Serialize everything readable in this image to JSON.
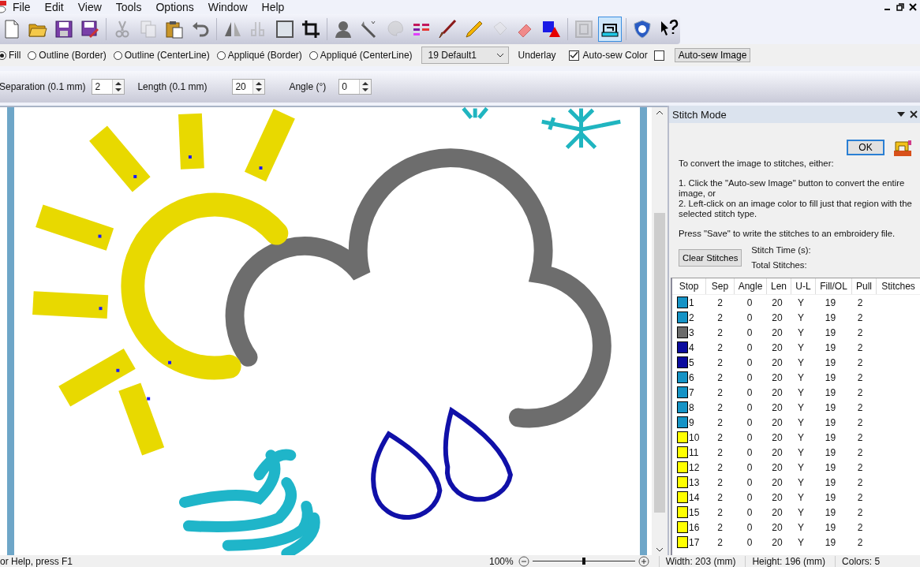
{
  "menu": [
    "File",
    "Edit",
    "View",
    "Tools",
    "Options",
    "Window",
    "Help"
  ],
  "toolbar": [
    {
      "selected": false,
      "disabled": false
    },
    {
      "selected": false,
      "disabled": false
    },
    {
      "selected": false,
      "disabled": false
    },
    {
      "selected": false,
      "disabled": false
    },
    {
      "selected": false,
      "disabled": true
    },
    {
      "selected": false,
      "disabled": true
    },
    {
      "selected": false,
      "disabled": false
    },
    {
      "selected": false,
      "disabled": false
    },
    {
      "selected": false,
      "disabled": false
    },
    {
      "selected": false,
      "disabled": true
    },
    {
      "selected": false,
      "disabled": false
    },
    {
      "selected": false,
      "disabled": false
    },
    {
      "selected": false,
      "disabled": false
    },
    {
      "selected": false,
      "disabled": false
    },
    {
      "selected": false,
      "disabled": true
    },
    {
      "selected": false,
      "disabled": false
    },
    {
      "selected": false,
      "disabled": false
    },
    {
      "selected": false,
      "disabled": false
    },
    {
      "selected": false,
      "disabled": true
    },
    {
      "selected": false,
      "disabled": false
    },
    {
      "selected": false,
      "disabled": false
    },
    {
      "selected": false,
      "disabled": true
    },
    {
      "selected": true,
      "disabled": false
    },
    {
      "selected": false,
      "disabled": false
    },
    {
      "selected": false,
      "disabled": false
    }
  ],
  "stitch_types": [
    {
      "label": "Fill",
      "selected": true
    },
    {
      "label": "Outline (Border)",
      "selected": false
    },
    {
      "label": "Outline (CenterLine)",
      "selected": false
    },
    {
      "label": "Appliqué (Border)",
      "selected": false
    },
    {
      "label": "Appliqué (CenterLine)",
      "selected": false
    }
  ],
  "preset": "19 Default1",
  "underlay_label": "Underlay",
  "auto_sew_color": {
    "label": "Auto-sew Color",
    "checked": true
  },
  "unlabeled_checkbox": {
    "checked": false
  },
  "auto_sew_image_button": "Auto-sew Image",
  "params": [
    {
      "label": "Separation (0.1 mm)",
      "value": "2"
    },
    {
      "label": "Length (0.1 mm)",
      "value": "20"
    },
    {
      "label": "Angle (°)",
      "value": "0"
    }
  ],
  "panel": {
    "title": "Stitch Mode",
    "ok": "OK",
    "intro": "To convert the image to stitches, either:",
    "step_1": "1. Click the \"Auto-sew Image\" button to convert the entire image, or",
    "step_2": "2. Left-click on an image color to fill just that region with the selected stitch type.",
    "save_note": "Press \"Save\" to write the stitches to an embroidery file.",
    "clear_button": "Clear Stitches",
    "stitch_time": "Stitch Time (s):",
    "total_stitches": "Total Stitches:"
  },
  "table": {
    "columns": [
      "Stop",
      "Sep",
      "Angle",
      "Len",
      "U-L",
      "Fill/OL",
      "Pull",
      "Stitches"
    ],
    "rows": [
      {
        "stop": "1",
        "color": "#1593c6",
        "sep": "2",
        "angle": "0",
        "len": "20",
        "ul": "Y",
        "fill": "19",
        "pull": "2"
      },
      {
        "stop": "2",
        "color": "#1593c6",
        "sep": "2",
        "angle": "0",
        "len": "20",
        "ul": "Y",
        "fill": "19",
        "pull": "2"
      },
      {
        "stop": "3",
        "color": "#6b6b6b",
        "sep": "2",
        "angle": "0",
        "len": "20",
        "ul": "Y",
        "fill": "19",
        "pull": "2"
      },
      {
        "stop": "4",
        "color": "#0a0a9e",
        "sep": "2",
        "angle": "0",
        "len": "20",
        "ul": "Y",
        "fill": "19",
        "pull": "2"
      },
      {
        "stop": "5",
        "color": "#0a0a9e",
        "sep": "2",
        "angle": "0",
        "len": "20",
        "ul": "Y",
        "fill": "19",
        "pull": "2"
      },
      {
        "stop": "6",
        "color": "#1593c6",
        "sep": "2",
        "angle": "0",
        "len": "20",
        "ul": "Y",
        "fill": "19",
        "pull": "2"
      },
      {
        "stop": "7",
        "color": "#1593c6",
        "sep": "2",
        "angle": "0",
        "len": "20",
        "ul": "Y",
        "fill": "19",
        "pull": "2"
      },
      {
        "stop": "8",
        "color": "#1593c6",
        "sep": "2",
        "angle": "0",
        "len": "20",
        "ul": "Y",
        "fill": "19",
        "pull": "2"
      },
      {
        "stop": "9",
        "color": "#1593c6",
        "sep": "2",
        "angle": "0",
        "len": "20",
        "ul": "Y",
        "fill": "19",
        "pull": "2"
      },
      {
        "stop": "10",
        "color": "#ffff00",
        "sep": "2",
        "angle": "0",
        "len": "20",
        "ul": "Y",
        "fill": "19",
        "pull": "2"
      },
      {
        "stop": "11",
        "color": "#ffff00",
        "sep": "2",
        "angle": "0",
        "len": "20",
        "ul": "Y",
        "fill": "19",
        "pull": "2"
      },
      {
        "stop": "12",
        "color": "#ffff00",
        "sep": "2",
        "angle": "0",
        "len": "20",
        "ul": "Y",
        "fill": "19",
        "pull": "2"
      },
      {
        "stop": "13",
        "color": "#ffff00",
        "sep": "2",
        "angle": "0",
        "len": "20",
        "ul": "Y",
        "fill": "19",
        "pull": "2"
      },
      {
        "stop": "14",
        "color": "#ffff00",
        "sep": "2",
        "angle": "0",
        "len": "20",
        "ul": "Y",
        "fill": "19",
        "pull": "2"
      },
      {
        "stop": "15",
        "color": "#ffff00",
        "sep": "2",
        "angle": "0",
        "len": "20",
        "ul": "Y",
        "fill": "19",
        "pull": "2"
      },
      {
        "stop": "16",
        "color": "#ffff00",
        "sep": "2",
        "angle": "0",
        "len": "20",
        "ul": "Y",
        "fill": "19",
        "pull": "2"
      },
      {
        "stop": "17",
        "color": "#ffff00",
        "sep": "2",
        "angle": "0",
        "len": "20",
        "ul": "Y",
        "fill": "19",
        "pull": "2"
      }
    ]
  },
  "status": {
    "help": "or Help, press F1",
    "zoom": "100%",
    "zoom_slider": {
      "level": 0.5
    },
    "width": "Width: 203 (mm)",
    "height": "Height: 196 (mm)",
    "colors": "Colors: 5"
  }
}
